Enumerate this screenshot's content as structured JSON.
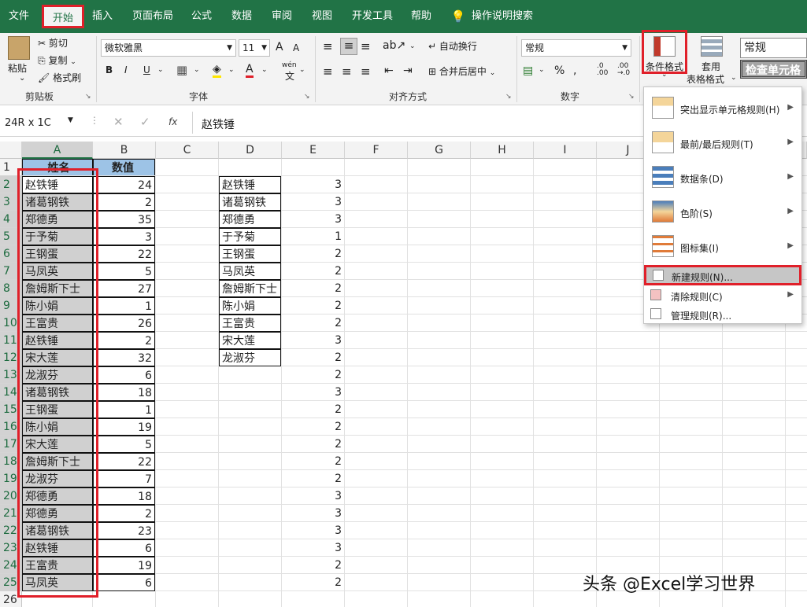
{
  "menubar": {
    "tabs": [
      "文件",
      "开始",
      "插入",
      "页面布局",
      "公式",
      "数据",
      "审阅",
      "视图",
      "开发工具",
      "帮助"
    ],
    "search": "操作说明搜索",
    "active": "开始"
  },
  "ribbon": {
    "clipboard": {
      "paste": "粘贴",
      "cut": "剪切",
      "copy": "复制",
      "format_painter": "格式刷",
      "label": "剪贴板"
    },
    "font": {
      "name": "微软雅黑",
      "size": "11",
      "label": "字体",
      "bold": "B",
      "italic": "I",
      "underline": "U",
      "grow": "A",
      "shrink": "A",
      "wen": "wén"
    },
    "alignment": {
      "wrap": "自动换行",
      "merge": "合并后居中",
      "label": "对齐方式"
    },
    "number": {
      "format": "常规",
      "label": "数字",
      "percent": "%"
    },
    "styles": {
      "conditional": "条件格式",
      "table_format_1": "套用",
      "table_format_2": "表格格式",
      "style_normal": "常规",
      "style_check": "检查单元格"
    }
  },
  "formula_bar": {
    "name_box": "24R x 1C",
    "fx": "fx",
    "value": "赵铁锤"
  },
  "columns": [
    "A",
    "B",
    "C",
    "D",
    "E",
    "F",
    "G",
    "H",
    "I",
    "J"
  ],
  "rows": [
    "1",
    "2",
    "3",
    "4",
    "5",
    "6",
    "7",
    "8",
    "9",
    "10",
    "11",
    "12",
    "13",
    "14",
    "15",
    "16",
    "17",
    "18",
    "19",
    "20",
    "21",
    "22",
    "23",
    "24",
    "25",
    "26"
  ],
  "headers": {
    "a": "姓名",
    "b": "数值"
  },
  "col_a": [
    "赵铁锤",
    "诸葛钢铁",
    "郑德勇",
    "于予菊",
    "王钢蛋",
    "马凤英",
    "詹姆斯下士",
    "陈小娟",
    "王富贵",
    "赵铁锤",
    "宋大莲",
    "龙淑芬",
    "诸葛钢铁",
    "王钢蛋",
    "陈小娟",
    "宋大莲",
    "詹姆斯下士",
    "龙淑芬",
    "郑德勇",
    "郑德勇",
    "诸葛钢铁",
    "赵铁锤",
    "王富贵",
    "马凤英"
  ],
  "col_b": [
    "24",
    "2",
    "35",
    "3",
    "22",
    "5",
    "27",
    "1",
    "26",
    "2",
    "32",
    "6",
    "18",
    "1",
    "19",
    "5",
    "22",
    "7",
    "18",
    "2",
    "23",
    "6",
    "19",
    "6"
  ],
  "col_d": [
    "赵铁锤",
    "诸葛钢铁",
    "郑德勇",
    "于予菊",
    "王钢蛋",
    "马凤英",
    "詹姆斯下士",
    "陈小娟",
    "王富贵",
    "宋大莲",
    "龙淑芬"
  ],
  "col_e": [
    "3",
    "3",
    "3",
    "1",
    "2",
    "2",
    "2",
    "2",
    "2",
    "3",
    "2",
    "2",
    "3",
    "2",
    "2",
    "2",
    "2",
    "2",
    "3",
    "3",
    "3",
    "3",
    "2",
    "2"
  ],
  "dropdown": {
    "items": [
      "突出显示单元格规则(H)",
      "最前/最后规则(T)",
      "数据条(D)",
      "色阶(S)",
      "图标集(I)"
    ],
    "new_rule": "新建规则(N)...",
    "clear_rule": "清除规则(C)",
    "manage_rule": "管理规则(R)..."
  },
  "watermark": "头条 @Excel学习世界"
}
